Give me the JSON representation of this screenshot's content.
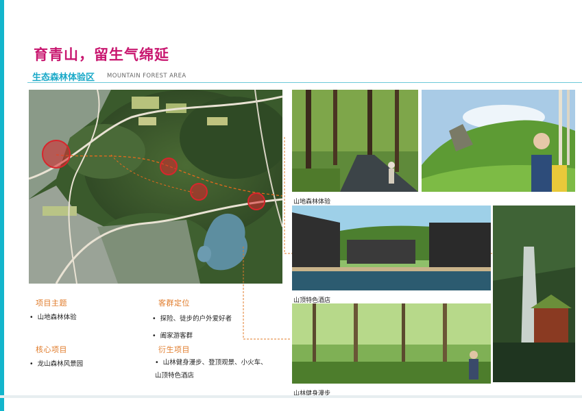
{
  "title": "育青山，留生气绵延",
  "subtitle_zh": "生态森林体验区",
  "subtitle_en": "MOUNTAIN FOREST AREA",
  "sections": {
    "theme": {
      "heading": "项目主题",
      "items": [
        "山地森林体验"
      ]
    },
    "core": {
      "heading": "核心项目",
      "items": [
        "龙山森林风景园"
      ]
    },
    "audience": {
      "heading": "客群定位",
      "items": [
        "探险、徒步的户外爱好者",
        "阖家游客群"
      ]
    },
    "derived": {
      "heading": "衍生项目",
      "items": [
        "山林健身漫步、登顶观景、小火车、",
        "山顶特色酒店"
      ]
    }
  },
  "captions": {
    "forest_experience": "山地森林体验",
    "hotel": "山顶特色酒店",
    "walk": "山林健身漫步"
  },
  "colors": {
    "title": "#c8166f",
    "subtitle": "#1aa9c8",
    "heading": "#e07b2a",
    "accent": "#13b5cc",
    "marker": "#d8262c"
  }
}
